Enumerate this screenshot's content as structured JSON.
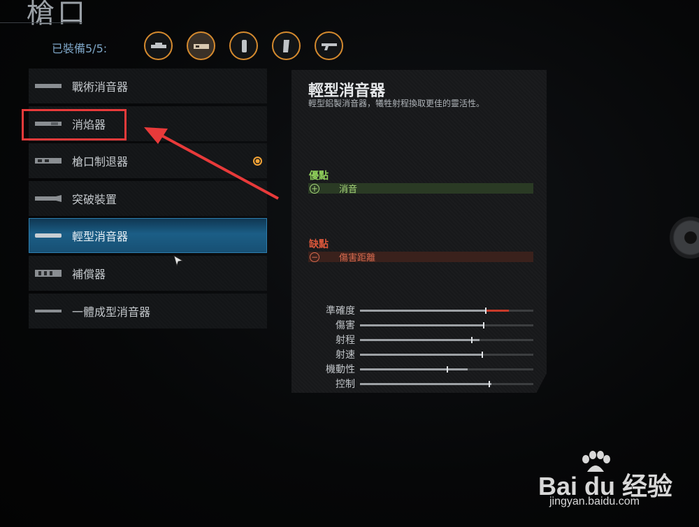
{
  "header": {
    "title": "槍口",
    "equipped": "已裝備5/5:"
  },
  "slots": [
    {
      "icon": "scope-icon"
    },
    {
      "icon": "muzzle-icon"
    },
    {
      "icon": "grip-icon"
    },
    {
      "icon": "magazine-icon"
    },
    {
      "icon": "stock-icon"
    }
  ],
  "attachments": [
    {
      "label": "戰術消音器"
    },
    {
      "label": "消焰器"
    },
    {
      "label": "槍口制退器"
    },
    {
      "label": "突破裝置"
    },
    {
      "label": "輕型消音器"
    },
    {
      "label": "補償器"
    },
    {
      "label": "一體成型消音器"
    }
  ],
  "selected_index": 4,
  "equipped_index": 2,
  "detail": {
    "title": "輕型消音器",
    "description": "輕型鋁製消音器，犧牲射程換取更佳的靈活性。",
    "pros_title": "優點",
    "pros": [
      "消音"
    ],
    "cons_title": "缺點",
    "cons": [
      "傷害距離"
    ],
    "stats": [
      {
        "name": "準確度",
        "base": 0.72,
        "new": 0.86
      },
      {
        "name": "傷害",
        "base": 0.71,
        "new": 0.71
      },
      {
        "name": "射程",
        "base": 0.64,
        "new": 0.69
      },
      {
        "name": "射速",
        "base": 0.7,
        "new": 0.7
      },
      {
        "name": "機動性",
        "base": 0.5,
        "new": 0.62
      },
      {
        "name": "控制",
        "base": 0.74,
        "new": 0.76
      }
    ]
  },
  "watermark": {
    "main": "Bai du 经验",
    "sub": "jingyan.baidu.com"
  },
  "colors": {
    "accent": "#d58a2e",
    "selection": "#1b5e86",
    "pros": "#8fcf5a",
    "cons": "#d9563a",
    "annotation": "#e83a3a"
  }
}
